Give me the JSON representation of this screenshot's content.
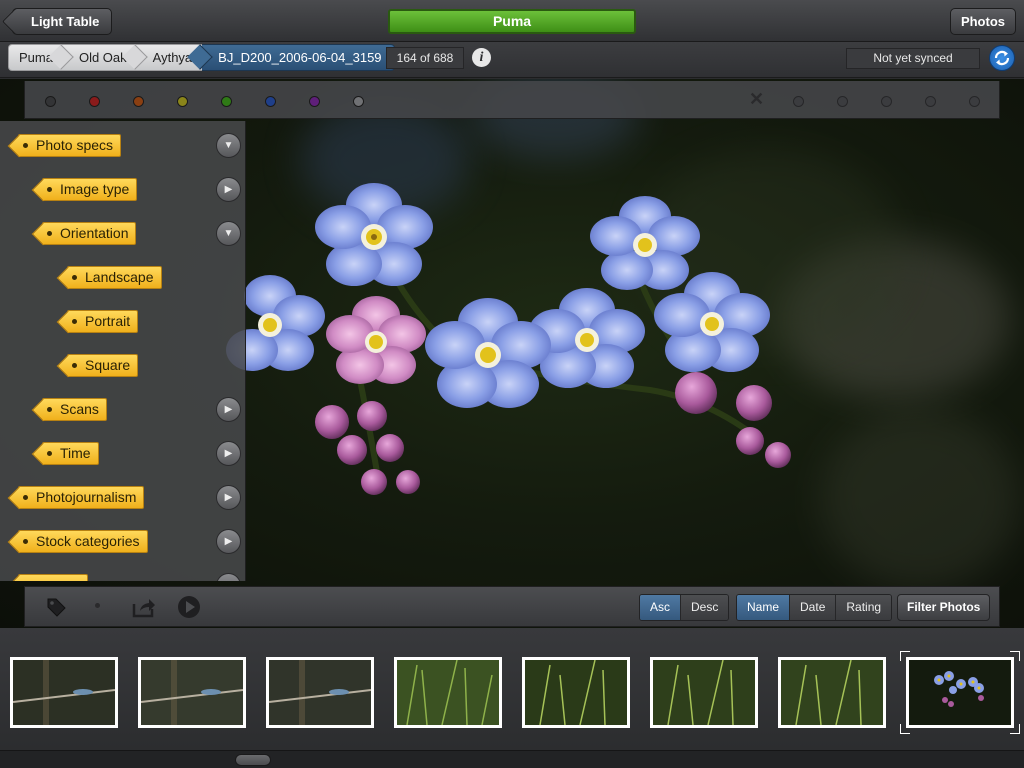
{
  "topbar": {
    "back_label": "Light Table",
    "title": "Puma",
    "photos_label": "Photos"
  },
  "breadcrumb": {
    "items": [
      "Puma",
      "Old Oak",
      "Aythya",
      "BJ_D200_2006-06-04_3159"
    ]
  },
  "counter": "164 of 688",
  "sync_status": "Not yet synced",
  "color_labels": [
    "#333436",
    "#8a1b1b",
    "#8a3f12",
    "#8a851a",
    "#2f7a16",
    "#1f3f8a",
    "#5f1f7a",
    "#707174"
  ],
  "keywords": [
    {
      "label": "Photo specs",
      "level": 0,
      "expander": "expanded"
    },
    {
      "label": "Image type",
      "level": 1,
      "expander": "collapsed"
    },
    {
      "label": "Orientation",
      "level": 1,
      "expander": "expanded"
    },
    {
      "label": "Landscape",
      "level": 2,
      "expander": "none"
    },
    {
      "label": "Portrait",
      "level": 2,
      "expander": "none"
    },
    {
      "label": "Square",
      "level": 2,
      "expander": "none"
    },
    {
      "label": "Scans",
      "level": 1,
      "expander": "collapsed"
    },
    {
      "label": "Time",
      "level": 1,
      "expander": "collapsed"
    },
    {
      "label": "Photojournalism",
      "level": 0,
      "expander": "collapsed"
    },
    {
      "label": "Stock categories",
      "level": 0,
      "expander": "collapsed"
    }
  ],
  "toolbar": {
    "sort_order": [
      "Asc",
      "Desc"
    ],
    "sort_order_selected": "Asc",
    "sort_by": [
      "Name",
      "Date",
      "Rating"
    ],
    "sort_by_selected": "Name",
    "filter_label": "Filter Photos"
  },
  "filmstrip": {
    "thumbnails": [
      "damselfly",
      "damselfly",
      "damselfly",
      "grass",
      "grass",
      "grass",
      "grass",
      "forget-me-not"
    ],
    "selected_index": 7
  },
  "icons": {
    "keyword_tag": "tag-icon",
    "share": "share-icon",
    "slideshow": "play-icon",
    "info": "info-icon",
    "sync": "sync-icon",
    "reject": "reject-icon",
    "expand": "chevron-down-icon",
    "collapse": "chevron-right-icon"
  }
}
